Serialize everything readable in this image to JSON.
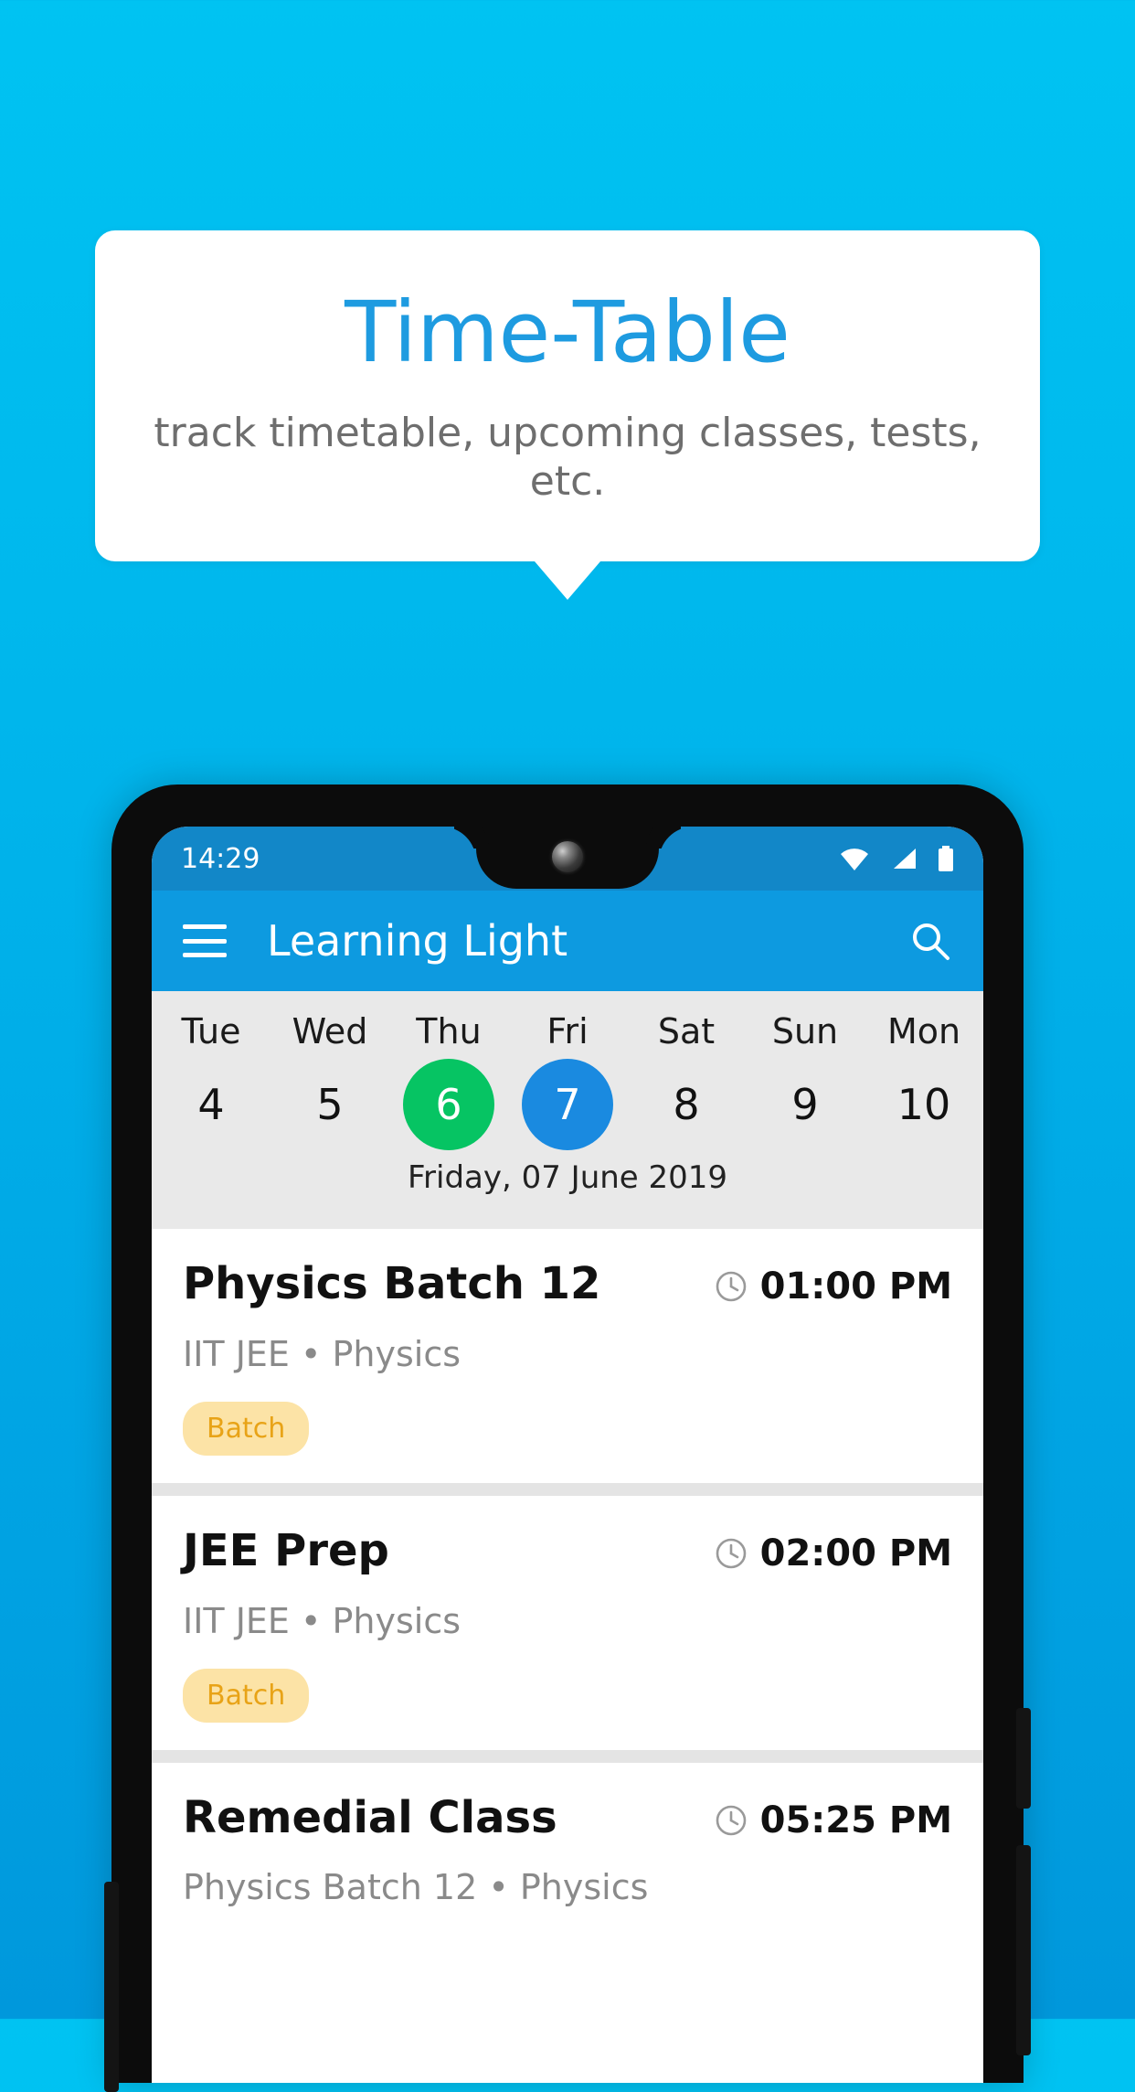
{
  "promo": {
    "title": "Time-Table",
    "subtitle": "track timetable, upcoming classes, tests, etc.",
    "title_color": "#1E9BE0",
    "subtitle_color": "#6E6E6E",
    "background_color": "#00B6EC"
  },
  "statusbar": {
    "time": "14:29",
    "icons": [
      "wifi-icon",
      "signal-icon",
      "battery-icon"
    ],
    "background_color": "#1287C8"
  },
  "appbar": {
    "menu_icon": "hamburger-menu-icon",
    "title": "Learning Light",
    "search_icon": "search-icon",
    "background_color": "#0D9AE0"
  },
  "datestrip": {
    "background_color": "#E9E9E9",
    "days": [
      {
        "label": "Tue",
        "num": "4",
        "state": "normal"
      },
      {
        "label": "Wed",
        "num": "5",
        "state": "normal"
      },
      {
        "label": "Thu",
        "num": "6",
        "state": "today"
      },
      {
        "label": "Fri",
        "num": "7",
        "state": "selected"
      },
      {
        "label": "Sat",
        "num": "8",
        "state": "normal"
      },
      {
        "label": "Sun",
        "num": "9",
        "state": "normal"
      },
      {
        "label": "Mon",
        "num": "10",
        "state": "normal"
      }
    ],
    "today_color": "#06C463",
    "selected_color": "#1A8AE0",
    "selected_date_label": "Friday, 07 June 2019"
  },
  "events": [
    {
      "title": "Physics Batch 12",
      "time": "01:00 PM",
      "time_icon": "clock-icon",
      "subtitle": "IIT JEE • Physics",
      "chip": "Batch"
    },
    {
      "title": "JEE Prep",
      "time": "02:00 PM",
      "time_icon": "clock-icon",
      "subtitle": "IIT JEE • Physics",
      "chip": "Batch"
    },
    {
      "title": "Remedial Class",
      "time": "05:25 PM",
      "time_icon": "clock-icon",
      "subtitle": "Physics Batch 12 • Physics",
      "chip": ""
    }
  ],
  "chip_colors": {
    "bg": "#FCE3A6",
    "fg": "#E8A317"
  }
}
